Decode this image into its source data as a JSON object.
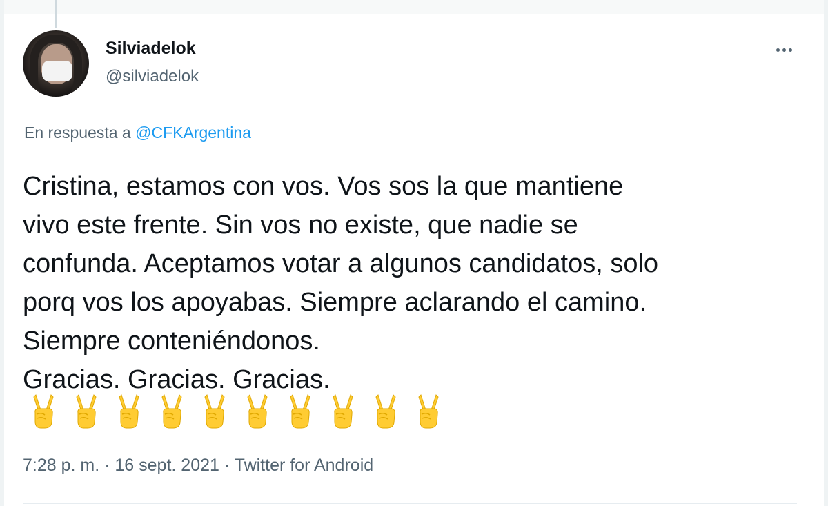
{
  "user": {
    "display_name": "Silviadelok",
    "handle": "@silviadelok"
  },
  "reply": {
    "prefix": "En respuesta a ",
    "mention": "@CFKArgentina"
  },
  "tweet": {
    "text": "Cristina, estamos con vos. Vos sos la que mantiene\nvivo este frente. Sin vos no existe, que nadie se\nconfunda. Aceptamos votar a algunos candidatos, solo\nporq vos los apoyabas. Siempre aclarando el camino.\nSiempre conteniéndonos.\nGracias. Gracias. Gracias.",
    "emoji_name": "victory-hand-icon",
    "emoji_count": 10
  },
  "meta": {
    "time": "7:28 p. m.",
    "separator": " · ",
    "date": "16 sept. 2021",
    "source": "Twitter for Android"
  },
  "colors": {
    "text": "#0f1419",
    "secondary": "#536471",
    "link": "#1d9bf0",
    "emoji": "#ffcc33"
  }
}
